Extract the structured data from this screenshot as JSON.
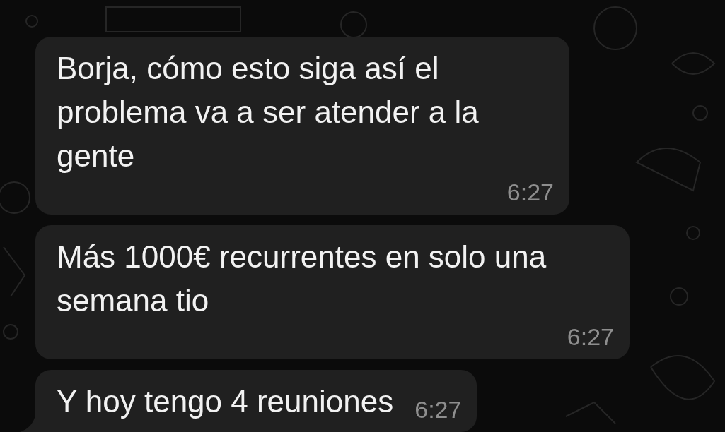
{
  "messages": [
    {
      "text": "Borja, cómo esto siga así el problema va a ser atender a la gente",
      "time": "6:27",
      "tail": false
    },
    {
      "text": "Más 1000€ recurrentes en solo una semana tio",
      "time": "6:27",
      "tail": false
    },
    {
      "text": "Y hoy tengo 4 reuniones",
      "time": "6:27",
      "tail": true
    }
  ]
}
